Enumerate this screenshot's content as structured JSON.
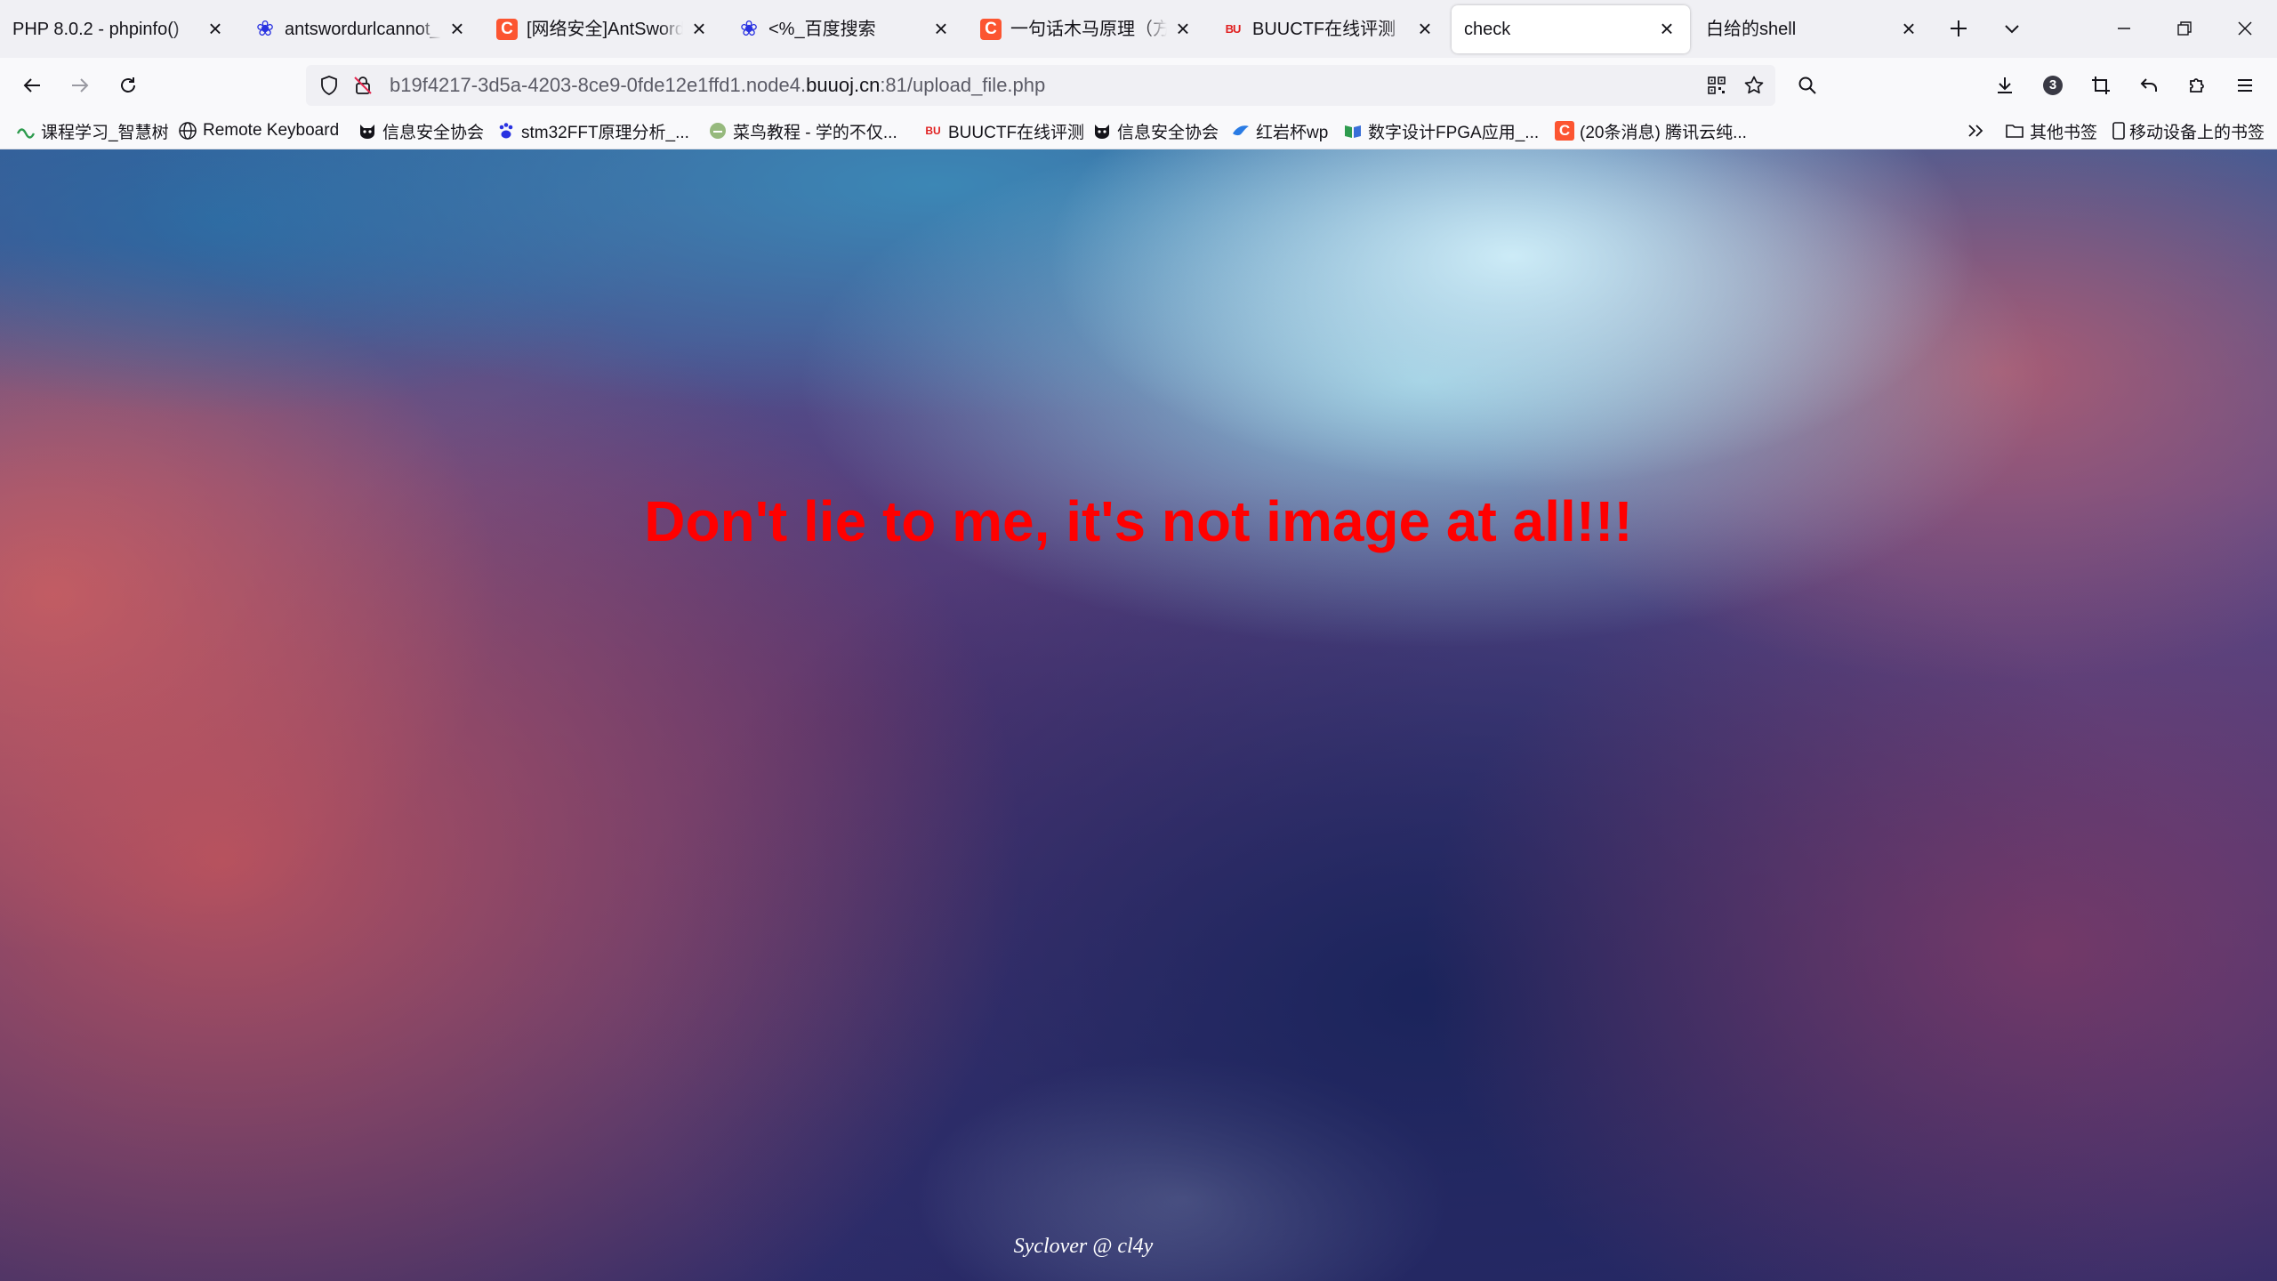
{
  "browser": {
    "tabs": [
      {
        "label": "PHP 8.0.2 - phpinfo()",
        "favicon": "none",
        "active": false
      },
      {
        "label": "antswordurlcannot_百度搜索",
        "favicon": "baidu-paw-icon",
        "active": false
      },
      {
        "label": "[网络安全]AntSword(蚁剑)",
        "favicon": "csdn-icon",
        "active": false
      },
      {
        "label": "<%_百度搜索",
        "favicon": "baidu-paw-icon",
        "active": false
      },
      {
        "label": "一句话木马原理（方法）",
        "favicon": "csdn-icon",
        "active": false
      },
      {
        "label": "BUUCTF在线评测",
        "favicon": "buuctf-icon",
        "active": false
      },
      {
        "label": "check",
        "favicon": "none",
        "active": true
      },
      {
        "label": "白给的shell",
        "favicon": "none",
        "active": false
      }
    ],
    "favicon_letters": {
      "csdn": "C",
      "buuctf": "BU"
    },
    "url": {
      "prefix": "b19f4217-3d5a-4203-8ce9-0fde12e1ffd1.node4.",
      "domain": "buuoj.cn",
      "suffix": ":81/upload_file.php"
    },
    "extension_badge_count": "3",
    "bookmarks": [
      {
        "label": "课程学习_智慧树",
        "icon": "zhihuishu-icon"
      },
      {
        "label": "Remote Keyboard",
        "icon": "globe-icon"
      },
      {
        "label": "信息安全协会",
        "icon": "cat-icon"
      },
      {
        "label": "stm32FFT原理分析_...",
        "icon": "baidu-paw-icon"
      },
      {
        "label": "菜鸟教程 - 学的不仅...",
        "icon": "runoob-icon"
      },
      {
        "label": "BUUCTF在线评测",
        "icon": "buuctf-icon"
      },
      {
        "label": "信息安全协会",
        "icon": "cat-icon"
      },
      {
        "label": "红岩杯wp",
        "icon": "bird-icon"
      },
      {
        "label": "数字设计FPGA应用_...",
        "icon": "book-icon"
      },
      {
        "label": "(20条消息) 腾讯云纯...",
        "icon": "csdn-icon"
      }
    ],
    "other_bookmarks": "其他书签",
    "mobile_bookmarks": "移动设备上的书签"
  },
  "page": {
    "message": "Don't lie to me, it's not image at all!!!",
    "footer": "Syclover @ cl4y",
    "message_color": "#ff0000"
  }
}
